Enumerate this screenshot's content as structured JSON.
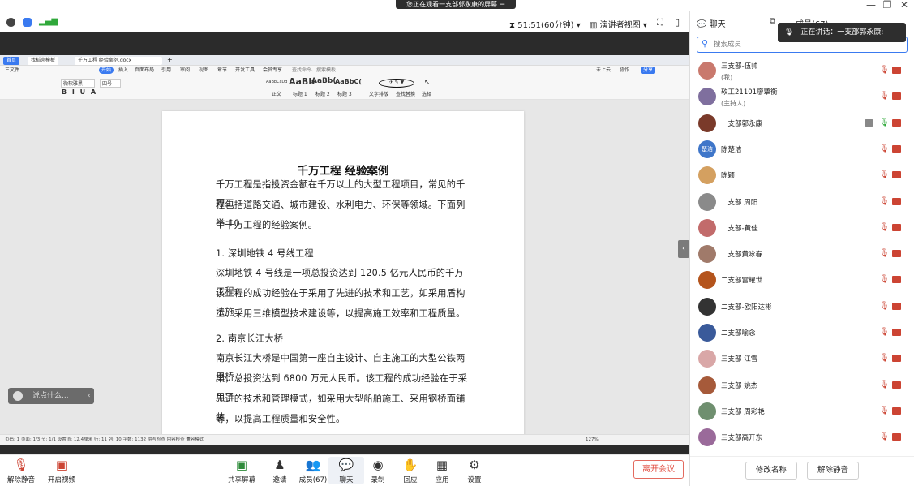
{
  "banner": {
    "text": "您正在观看一支部郭永康的屏幕",
    "icon": "menu-icon"
  },
  "window": {
    "minimize": "—",
    "restore": "❐",
    "close": "✕"
  },
  "topbar": {
    "timer": "51:51(60分钟)",
    "view_mode": "演讲者视图",
    "timer_icon": "hourglass-icon"
  },
  "wps": {
    "tabs": [
      "首页",
      "找稻壳模板",
      "千万工程 经验案例.docx"
    ],
    "menu": [
      "三文件",
      "开始",
      "插入",
      "页面布局",
      "引用",
      "审阅",
      "视图",
      "章节",
      "开发工具",
      "会员专享",
      "查找命令、搜索模板"
    ],
    "menu_right": [
      "未上云",
      "协作",
      "分享"
    ],
    "ribbon": {
      "font_name": "微软雅黑",
      "font_size": "四号",
      "styles": [
        "AaBbCcDd",
        "AaBb",
        "AaBb(",
        "AaBbC("
      ],
      "style_labels": [
        "正文",
        "标题 1",
        "标题 2",
        "标题 3"
      ],
      "extra": [
        "文字排版",
        "查找替换",
        "选择"
      ]
    },
    "status": "页码: 1 页面: 1/3 节: 1/1 设置值: 12.4厘米 行: 11 列: 10 字数: 1132 拼写检查 内容检查 兼容模式",
    "zoom": "127%"
  },
  "doc": {
    "title": "千万工程 经验案例",
    "lines": [
      "千万工程是指投资金额在千万以上的大型工程项目，常见的千万工",
      "程包括道路交通、城市建设、水利电力、环保等领域。下面列举 10",
      "个千万工程的经验案例。",
      "1. 深圳地铁 4 号线工程",
      "深圳地铁 4 号线是一项总投资达到 120.5 亿元人民币的千万工程，",
      "该工程的成功经验在于采用了先进的技术和工艺，如采用盾构法施",
      "工、采用三维模型技术建设等，以提高施工效率和工程质量。",
      "2. 南京长江大桥",
      "南京长江大桥是中国第一座自主设计、自主施工的大型公铁两用桥",
      "梁，总投资达到 6800 万元人民币。该工程的成功经验在于采用了",
      "先进的技术和管理模式，如采用大型船舶施工、采用钢桥面铺装",
      "等，以提高工程质量和安全性。"
    ]
  },
  "chat_input": {
    "placeholder": "说点什么..."
  },
  "toolbar": {
    "left": [
      {
        "label": "解除静音",
        "icon": "mic-muted-icon"
      },
      {
        "label": "开启视频",
        "icon": "video-off-icon"
      }
    ],
    "center": [
      {
        "label": "共享屏幕",
        "icon": "share-screen-icon"
      },
      {
        "label": "邀请",
        "icon": "invite-icon"
      },
      {
        "label": "成员(67)",
        "icon": "members-icon"
      },
      {
        "label": "聊天",
        "icon": "chat-icon"
      },
      {
        "label": "录制",
        "icon": "record-icon"
      },
      {
        "label": "回应",
        "icon": "reaction-icon"
      },
      {
        "label": "应用",
        "icon": "apps-icon"
      },
      {
        "label": "设置",
        "icon": "settings-icon"
      }
    ],
    "leave": "离开会议"
  },
  "panel": {
    "chat_tab": "聊天",
    "members_tab": "成员(67)",
    "speaking": "正在讲话：一支部郭永康;",
    "search_placeholder": "搜索成员",
    "rename": "修改名称",
    "unmute": "解除静音",
    "members": [
      {
        "name": "三支部-伍帅",
        "sub": "(我)",
        "avatar": "#c9796d"
      },
      {
        "name": "软工21101廖蕈衡",
        "sub": "(主持人)",
        "avatar": "#7f6f9e"
      },
      {
        "name": "一支部郭永康",
        "sub": "",
        "avatar": "#7a3a2a",
        "active": true
      },
      {
        "name": "陈楚洁",
        "sub": "",
        "avatar": "#3f76c9",
        "initials": "楚洁"
      },
      {
        "name": "陈颖",
        "sub": "",
        "avatar": "#d4a060"
      },
      {
        "name": "二支部 周阳",
        "sub": "",
        "avatar": "#8a8a8a"
      },
      {
        "name": "二支部-黄佳",
        "sub": "",
        "avatar": "#c26b6b"
      },
      {
        "name": "二支部黄咏春",
        "sub": "",
        "avatar": "#a07a6a"
      },
      {
        "name": "二支部雷耀世",
        "sub": "",
        "avatar": "#b4541c"
      },
      {
        "name": "二支部-欧阳达彬",
        "sub": "",
        "avatar": "#333333"
      },
      {
        "name": "二支部喻念",
        "sub": "",
        "avatar": "#3a5a9a"
      },
      {
        "name": "三支部 江雪",
        "sub": "",
        "avatar": "#d9a7a7"
      },
      {
        "name": "三支部 姚杰",
        "sub": "",
        "avatar": "#a65a3a"
      },
      {
        "name": "三支部 周彩艳",
        "sub": "",
        "avatar": "#6f8f6f"
      },
      {
        "name": "三支部高开东",
        "sub": "",
        "avatar": "#9a6a9a"
      }
    ]
  },
  "colors": {
    "accent": "#3a7af0",
    "danger": "#e0473a",
    "mic_muted": "#c43"
  }
}
